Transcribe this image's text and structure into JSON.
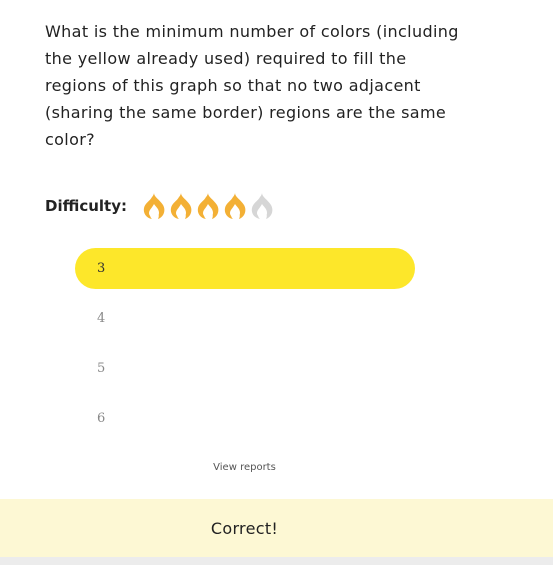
{
  "question": {
    "text": "What is the minimum number of colors (including the yellow already used) required to fill the regions of this graph so that no two adjacent (sharing the same border) regions are the same color?"
  },
  "difficulty": {
    "label": "Difficulty:",
    "level": 4,
    "max": 5,
    "active_color": "#f3b035",
    "inactive_color": "#d6d6d6",
    "icon": "flame-icon"
  },
  "options": [
    {
      "label": "3",
      "selected": true
    },
    {
      "label": "4",
      "selected": false
    },
    {
      "label": "5",
      "selected": false
    },
    {
      "label": "6",
      "selected": false
    }
  ],
  "view_reports_label": "View reports",
  "result": {
    "text": "Correct!",
    "background": "#fdf8d4"
  },
  "colors": {
    "selected_option": "#fde72a"
  }
}
